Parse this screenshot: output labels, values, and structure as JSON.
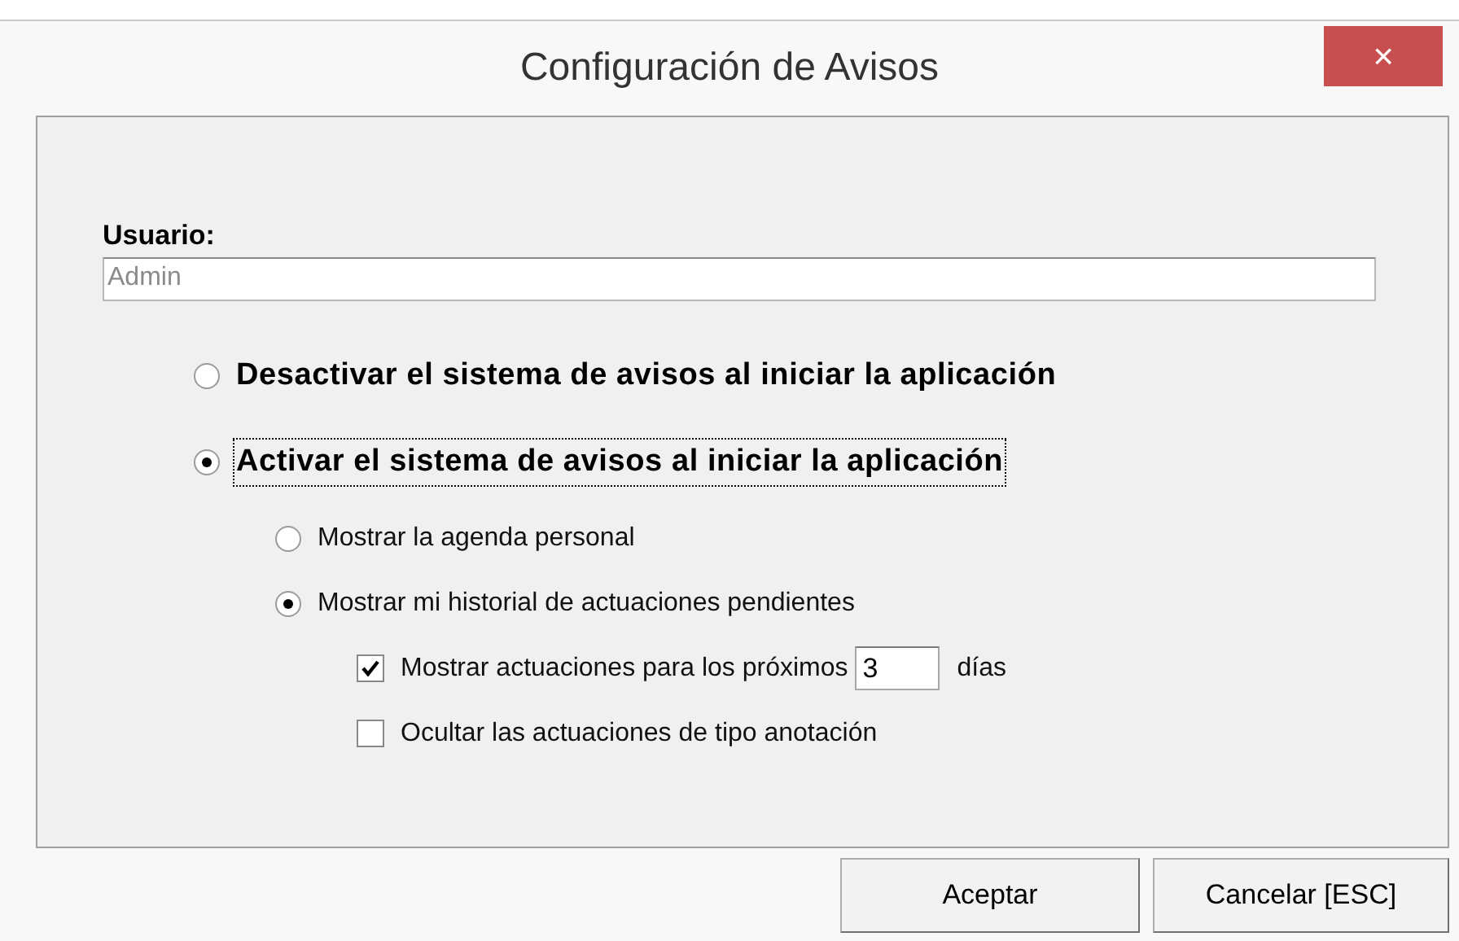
{
  "window": {
    "title": "Configuración de Avisos",
    "close": "×"
  },
  "user": {
    "label": "Usuario:",
    "value": "Admin"
  },
  "options": [
    {
      "kind": "radio",
      "label": "Desactivar el sistema de avisos al iniciar la aplicación",
      "bold": true,
      "selected": false,
      "focused": false
    },
    {
      "kind": "radio",
      "label": "Activar el sistema de avisos al iniciar la aplicación",
      "bold": true,
      "selected": true,
      "focused": true,
      "children": [
        {
          "kind": "radio",
          "label": "Mostrar la agenda personal",
          "selected": false
        },
        {
          "kind": "radio",
          "label": "Mostrar mi historial de actuaciones pendientes",
          "selected": true,
          "children": [
            {
              "kind": "checkbox",
              "label": "Mostrar actuaciones para los próximos",
              "checked": true,
              "field": {
                "value": "3"
              },
              "suffix": "días"
            },
            {
              "kind": "checkbox",
              "label": "Ocultar las actuaciones de tipo anotación",
              "checked": false
            }
          ]
        }
      ]
    }
  ],
  "buttons": [
    "Aceptar",
    "Cancelar [ESC]"
  ]
}
